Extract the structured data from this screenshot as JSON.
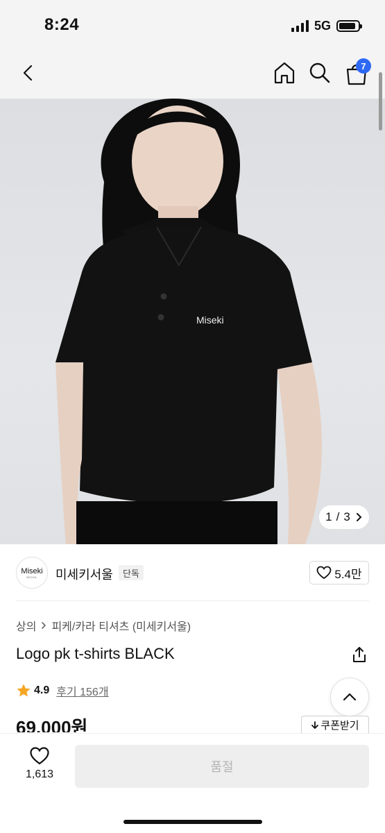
{
  "status_bar": {
    "time": "8:24",
    "network": "5G",
    "battery_level": 0.9
  },
  "nav": {
    "cart_count": "7"
  },
  "gallery": {
    "current": "1",
    "separator": "/",
    "total": "3",
    "next_icon": "chevron-right-icon",
    "shirt_logo": "Miseki"
  },
  "brand": {
    "logo_text": "Miseki",
    "logo_subtext": "SEOUL",
    "name": "미세키서울",
    "tag": "단독",
    "likes": "5.4만"
  },
  "breadcrumb": {
    "category": "상의",
    "subcategory": "피케/카라 티셔츠 (미세키서울)"
  },
  "product": {
    "title": "Logo pk t-shirts BLACK",
    "rating": "4.9",
    "reviews": "후기 156개",
    "price": "69,000원",
    "coupon_label": "쿠폰받기"
  },
  "bottom_bar": {
    "wish_count": "1,613",
    "buy_label": "품절"
  },
  "colors": {
    "accent": "#2e68f5",
    "star": "#f5a623",
    "disabled_bg": "#eeeeee",
    "disabled_text": "#b5b5b5"
  }
}
